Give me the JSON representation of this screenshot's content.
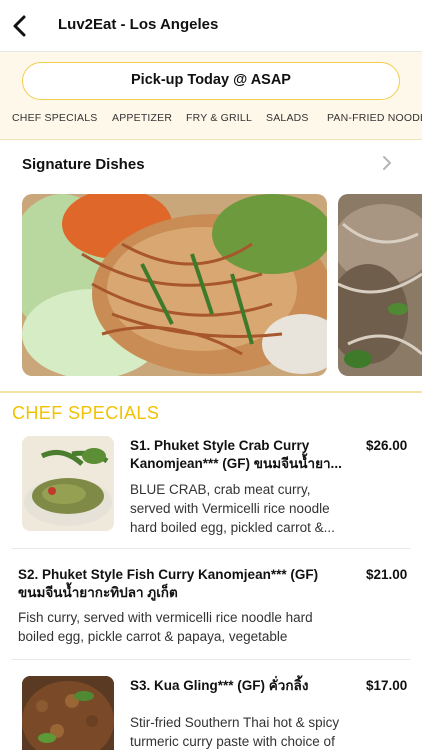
{
  "header": {
    "title": "Luv2Eat - Los Angeles"
  },
  "pickup": {
    "label": "Pick-up Today @ ASAP"
  },
  "tabs": [
    "CHEF  SPECIALS",
    "APPETIZER",
    "FRY & GRILL",
    "SALADS",
    "PAN-FRIED NOODLE"
  ],
  "signature": {
    "title": "Signature Dishes"
  },
  "category": {
    "title": "CHEF  SPECIALS"
  },
  "items": [
    {
      "title1": "S1. Phuket Style Crab Curry",
      "title2": "Kanomjean*** (GF) ขนมจีนน้ำยา...",
      "price": "$26.00",
      "desc1": "BLUE CRAB, crab meat curry,",
      "desc2": "served with Vermicelli rice noodle",
      "desc3": "hard boiled egg, pickled carrot &..."
    },
    {
      "title1": "S2. Phuket Style Fish Curry Kanomjean*** (GF)",
      "title2": "ขนมจีนน้ำยากะทิปลา ภูเก็ต",
      "price": "$21.00",
      "desc1": "Fish curry, served with vermicelli rice noodle hard",
      "desc2": "boiled egg, pickle carrot & papaya, vegetable"
    },
    {
      "title1": "S3. Kua Gling*** (GF) คั่วกลิ้ง",
      "price": "$17.00",
      "desc1": "Stir-fried Southern Thai hot & spicy",
      "desc2": "turmeric curry paste with choice of"
    }
  ],
  "icons": {
    "back": "back-arrow-icon",
    "chevron": "chevron-right-icon"
  },
  "colors": {
    "accent": "#f2c200",
    "border": "#f2cd4e",
    "band": "#fdf8ea"
  }
}
